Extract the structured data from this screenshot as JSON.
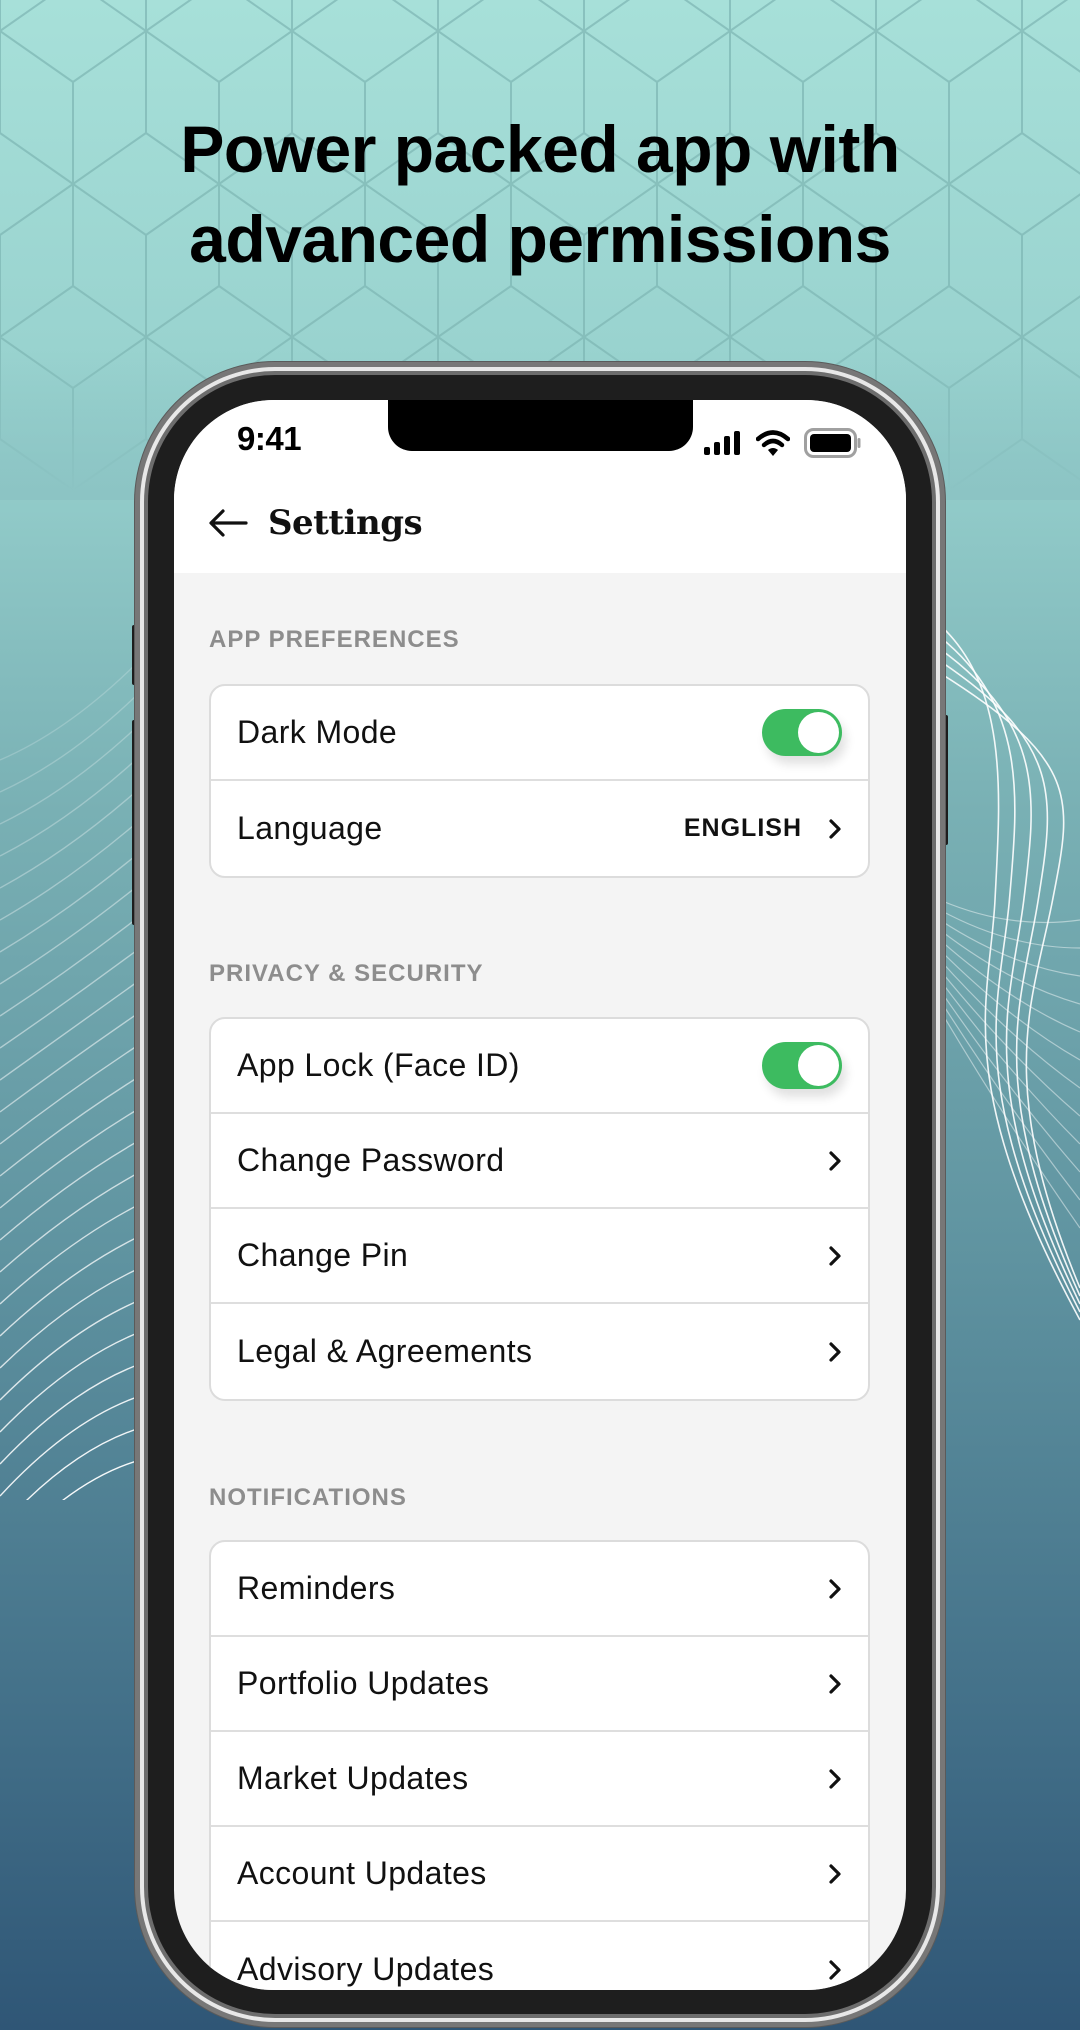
{
  "headline": {
    "line1": "Power packed app with",
    "line2": "advanced permissions"
  },
  "status_bar": {
    "time": "9:41",
    "icons": [
      "cellular-signal-icon",
      "wifi-icon",
      "battery-icon"
    ]
  },
  "header": {
    "back_icon": "arrow-left-icon",
    "title": "Settings"
  },
  "sections": [
    {
      "label": "APP PREFERENCES",
      "items": [
        {
          "label": "Dark Mode",
          "type": "toggle",
          "on": true
        },
        {
          "label": "Language",
          "type": "link",
          "value": "ENGLISH"
        }
      ]
    },
    {
      "label": "PRIVACY & SECURITY",
      "items": [
        {
          "label": "App Lock (Face ID)",
          "type": "toggle",
          "on": true
        },
        {
          "label": "Change Password",
          "type": "link"
        },
        {
          "label": "Change Pin",
          "type": "link"
        },
        {
          "label": "Legal & Agreements",
          "type": "link"
        }
      ]
    },
    {
      "label": "NOTIFICATIONS",
      "items": [
        {
          "label": "Reminders",
          "type": "link"
        },
        {
          "label": "Portfolio Updates",
          "type": "link"
        },
        {
          "label": "Market Updates",
          "type": "link"
        },
        {
          "label": "Account Updates",
          "type": "link"
        },
        {
          "label": "Advisory Updates",
          "type": "link"
        }
      ]
    }
  ],
  "colors": {
    "toggle_on": "#3dbb60",
    "section_label": "#8d8d8d",
    "screen_bg": "#f4f4f4",
    "bg_top": "#a7e0d9",
    "bg_bottom": "#2f5676"
  }
}
